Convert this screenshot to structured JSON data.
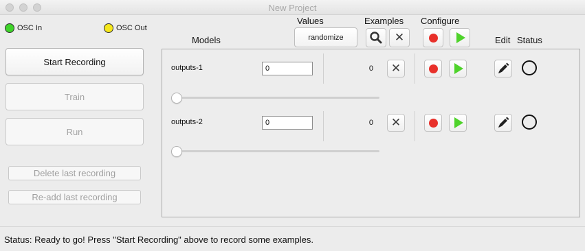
{
  "window": {
    "title": "New Project"
  },
  "osc": {
    "in_label": "OSC In",
    "out_label": "OSC Out",
    "in_color": "#3fd42a",
    "out_color": "#f5e71b"
  },
  "controls": {
    "start_recording": "Start Recording",
    "train": "Train",
    "run": "Run",
    "delete_last": "Delete last recording",
    "readd_last": "Re-add last recording"
  },
  "headers": {
    "models": "Models",
    "values": "Values",
    "examples": "Examples",
    "configure": "Configure",
    "edit": "Edit",
    "status": "Status"
  },
  "values": {
    "randomize_label": "randomize"
  },
  "icons": {
    "examples_search": "magnifier-icon",
    "examples_delete": "x-icon",
    "record": "record-icon",
    "play": "play-icon",
    "edit": "pencil-icon"
  },
  "colors": {
    "record": "#e8302a",
    "play": "#4fd32b"
  },
  "models": [
    {
      "name": "outputs-1",
      "value": "0",
      "examples_count": "0",
      "slider_value": 0
    },
    {
      "name": "outputs-2",
      "value": "0",
      "examples_count": "0",
      "slider_value": 0
    }
  ],
  "status": {
    "text": "Status: Ready to go! Press \"Start Recording\" above to record some examples."
  }
}
